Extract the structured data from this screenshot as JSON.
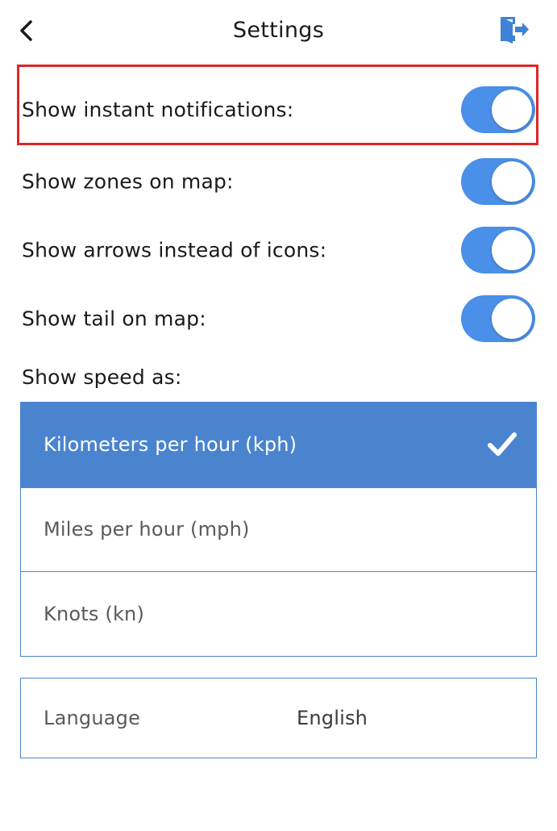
{
  "header": {
    "title": "Settings",
    "back_icon": "chevron-left-icon",
    "logout_icon": "logout-door-icon"
  },
  "toggles": [
    {
      "label": "Show instant notifications:",
      "on": true
    },
    {
      "label": "Show zones on map:",
      "on": true
    },
    {
      "label": "Show arrows instead of icons:",
      "on": true
    },
    {
      "label": "Show tail on map:",
      "on": true
    }
  ],
  "speed": {
    "label": "Show speed as:",
    "options": [
      {
        "label": "Kilometers per hour (kph)",
        "selected": true
      },
      {
        "label": "Miles per hour (mph)",
        "selected": false
      },
      {
        "label": "Knots (kn)",
        "selected": false
      }
    ]
  },
  "language": {
    "label": "Language",
    "value": "English"
  },
  "colors": {
    "accent": "#4a84cf",
    "toggle_on": "#4a8fe8",
    "highlight": "#e02424"
  }
}
